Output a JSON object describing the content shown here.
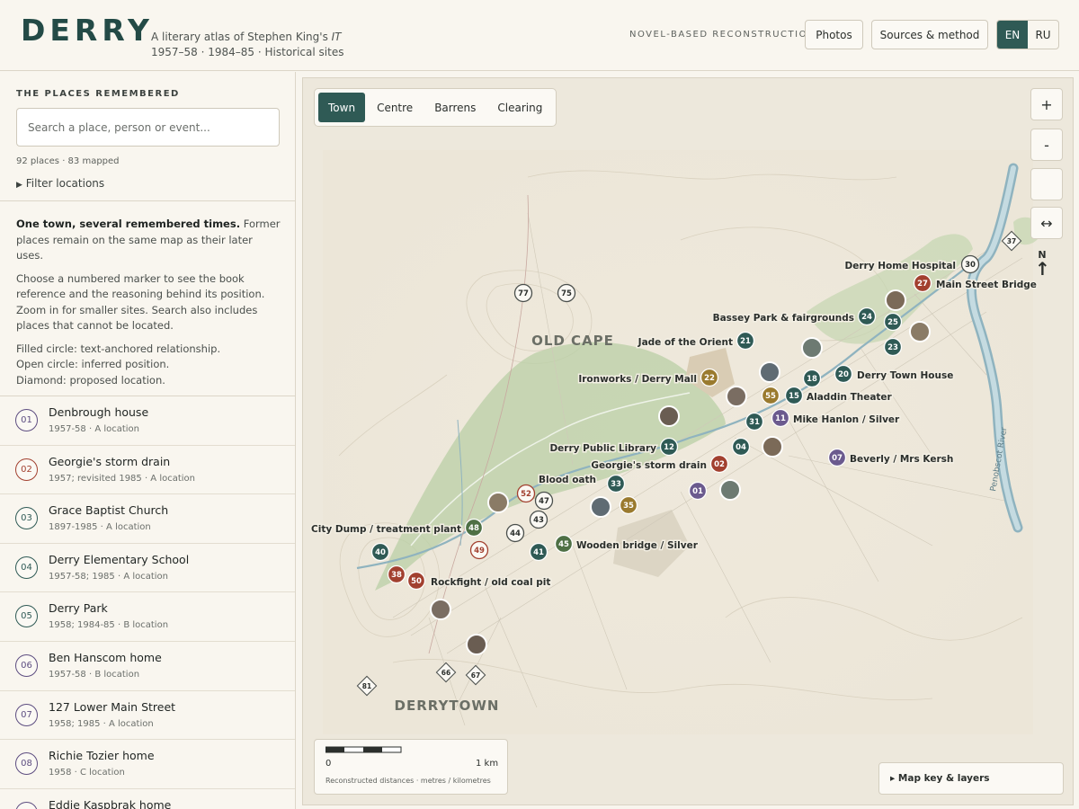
{
  "header": {
    "logo": "DERRY",
    "tagline_line1_prefix": "A literary atlas of Stephen King's ",
    "tagline_line1_italic": "IT",
    "tagline_line2": "1957–58 · 1984–85 · Historical sites",
    "label": "NOVEL-BASED RECONSTRUCTION",
    "photos_button": "Photos",
    "sources_button": "Sources & method",
    "lang_en": "EN",
    "lang_ru": "RU"
  },
  "sidebar": {
    "title": "THE PLACES REMEMBERED",
    "search_placeholder": "Search a place, person or event...",
    "count": "92 places · 83 mapped",
    "filter": "Filter locations",
    "intro_bold": "One town, several remembered times.",
    "intro_rest": " Former places remain on the same map as their later uses.",
    "intro_p2": "Choose a numbered marker to see the book reference and the reasoning behind its position. Zoom in for smaller sites. Search also includes places that cannot be located.",
    "intro_p3a": "Filled circle: text-anchored relationship.",
    "intro_p3b": "Open circle: inferred position.",
    "intro_p3c": "Diamond: proposed location.",
    "items": [
      {
        "num": "01",
        "name": "Denbrough house",
        "meta": "1957-58 · A location",
        "color": "#5d4d80"
      },
      {
        "num": "02",
        "name": "Georgie's storm drain",
        "meta": "1957; revisited 1985 · A location",
        "color": "#a2402f"
      },
      {
        "num": "03",
        "name": "Grace Baptist Church",
        "meta": "1897-1985 · A location",
        "color": "#2f5a55"
      },
      {
        "num": "04",
        "name": "Derry Elementary School",
        "meta": "1957-58; 1985 · A location",
        "color": "#2f5a55"
      },
      {
        "num": "05",
        "name": "Derry Park",
        "meta": "1958; 1984-85 · B location",
        "color": "#2f5a55"
      },
      {
        "num": "06",
        "name": "Ben Hanscom home",
        "meta": "1957-58 · B location",
        "color": "#5d4d80"
      },
      {
        "num": "07",
        "name": "127 Lower Main Street",
        "meta": "1958; 1985 · A location",
        "color": "#5d4d80"
      },
      {
        "num": "08",
        "name": "Richie Tozier home",
        "meta": "1958 · C location",
        "color": "#5d4d80"
      },
      {
        "num": "",
        "name": "Eddie Kaspbrak home",
        "meta": "",
        "color": "#5d4d80"
      }
    ]
  },
  "map": {
    "tabs": [
      "Town",
      "Centre",
      "Barrens",
      "Clearing"
    ],
    "zoom_in": "+",
    "zoom_out": "-",
    "fit": "↔",
    "north": "N",
    "area_labels": {
      "old_cape": "OLD CAPE",
      "derrytown": "DERRYTOWN",
      "river": "Penobscot River"
    },
    "scale_zero": "0",
    "scale_km": "1 km",
    "scale_note": "Reconstructed distances · metres / kilometres",
    "key_button": "▸ Map key & layers",
    "place_labels": [
      {
        "id": "hospital",
        "text": "Derry Home Hospital"
      },
      {
        "id": "mainst",
        "text": "Main Street Bridge"
      },
      {
        "id": "bassey",
        "text": "Bassey Park & fairgrounds"
      },
      {
        "id": "jade",
        "text": "Jade of the Orient"
      },
      {
        "id": "ironworks",
        "text": "Ironworks / Derry Mall"
      },
      {
        "id": "townhouse",
        "text": "Derry Town House"
      },
      {
        "id": "aladdin",
        "text": "Aladdin Theater"
      },
      {
        "id": "hanlon",
        "text": "Mike Hanlon / Silver"
      },
      {
        "id": "library",
        "text": "Derry Public Library"
      },
      {
        "id": "beverly",
        "text": "Beverly / Mrs Kersh"
      },
      {
        "id": "drain",
        "text": "Georgie's storm drain"
      },
      {
        "id": "oath",
        "text": "Blood oath"
      },
      {
        "id": "dump",
        "text": "City Dump / treatment plant"
      },
      {
        "id": "bridge",
        "text": "Wooden bridge / Silver"
      },
      {
        "id": "rockfight",
        "text": "Rockfight / old coal pit"
      }
    ],
    "markers": [
      {
        "n": "30",
        "style": "open"
      },
      {
        "n": "37",
        "style": "diamond"
      },
      {
        "n": "27",
        "style": "red"
      },
      {
        "n": "24",
        "style": "teal"
      },
      {
        "n": "25",
        "style": "teal"
      },
      {
        "n": "23",
        "style": "teal"
      },
      {
        "n": "21",
        "style": "teal"
      },
      {
        "n": "22",
        "style": "gold"
      },
      {
        "n": "18",
        "style": "teal"
      },
      {
        "n": "20",
        "style": "teal"
      },
      {
        "n": "55",
        "style": "gold"
      },
      {
        "n": "15",
        "style": "teal"
      },
      {
        "n": "31",
        "style": "teal"
      },
      {
        "n": "11",
        "style": "purple"
      },
      {
        "n": "04",
        "style": "teal"
      },
      {
        "n": "12",
        "style": "teal"
      },
      {
        "n": "07",
        "style": "purple"
      },
      {
        "n": "02",
        "style": "red"
      },
      {
        "n": "01",
        "style": "purple"
      },
      {
        "n": "33",
        "style": "teal"
      },
      {
        "n": "35",
        "style": "gold"
      },
      {
        "n": "52",
        "style": "open-red"
      },
      {
        "n": "47",
        "style": "open"
      },
      {
        "n": "43",
        "style": "open"
      },
      {
        "n": "44",
        "style": "open"
      },
      {
        "n": "48",
        "style": "green"
      },
      {
        "n": "45",
        "style": "green"
      },
      {
        "n": "41",
        "style": "teal"
      },
      {
        "n": "49",
        "style": "open-red"
      },
      {
        "n": "40",
        "style": "teal"
      },
      {
        "n": "38",
        "style": "red"
      },
      {
        "n": "50",
        "style": "red"
      },
      {
        "n": "77",
        "style": "open"
      },
      {
        "n": "75",
        "style": "open"
      },
      {
        "n": "66",
        "style": "diamond"
      },
      {
        "n": "67",
        "style": "diamond"
      },
      {
        "n": "81",
        "style": "diamond"
      }
    ]
  }
}
